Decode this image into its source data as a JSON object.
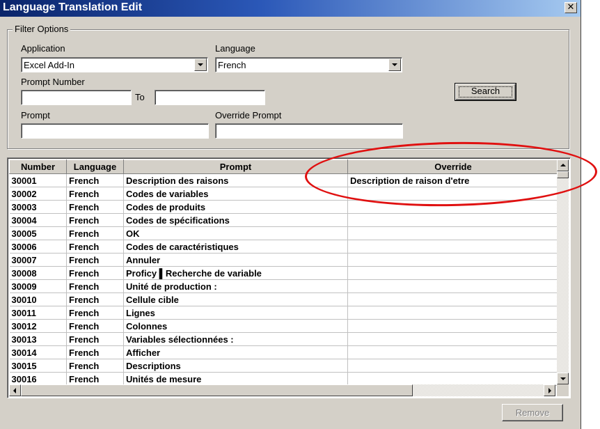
{
  "window": {
    "title": "Language Translation Edit",
    "close_symbol": "✕"
  },
  "filter": {
    "legend": "Filter Options",
    "application": {
      "label": "Application",
      "value": "Excel Add-In"
    },
    "language": {
      "label": "Language",
      "value": "French"
    },
    "prompt_number": {
      "label": "Prompt Number",
      "to_label": "To",
      "from_value": "",
      "to_value": ""
    },
    "prompt": {
      "label": "Prompt",
      "value": ""
    },
    "override_prompt": {
      "label": "Override Prompt",
      "value": ""
    },
    "search_label": "Search"
  },
  "grid": {
    "columns": [
      "Number",
      "Language",
      "Prompt",
      "Override"
    ],
    "rows": [
      [
        "30001",
        "French",
        "Description des raisons",
        "Description de raison d'etre"
      ],
      [
        "30002",
        "French",
        "Codes de variables",
        ""
      ],
      [
        "30003",
        "French",
        "Codes de produits",
        ""
      ],
      [
        "30004",
        "French",
        "Codes de spécifications",
        ""
      ],
      [
        "30005",
        "French",
        "OK",
        ""
      ],
      [
        "30006",
        "French",
        "Codes de caractéristiques",
        ""
      ],
      [
        "30007",
        "French",
        "Annuler",
        ""
      ],
      [
        "30008",
        "French",
        "Proficy ▌Recherche de variable",
        ""
      ],
      [
        "30009",
        "French",
        "Unité de production :",
        ""
      ],
      [
        "30010",
        "French",
        "Cellule cible",
        ""
      ],
      [
        "30011",
        "French",
        "Lignes",
        ""
      ],
      [
        "30012",
        "French",
        "Colonnes",
        ""
      ],
      [
        "30013",
        "French",
        "Variables sélectionnées :",
        ""
      ],
      [
        "30014",
        "French",
        "Afficher",
        ""
      ],
      [
        "30015",
        "French",
        "Descriptions",
        ""
      ],
      [
        "30016",
        "French",
        "Unités de mesure",
        ""
      ]
    ]
  },
  "footer": {
    "remove_label": "Remove"
  },
  "colors": {
    "annotation": "#e01010",
    "titlebar_start": "#0a246a",
    "titlebar_end": "#a6caf0"
  }
}
